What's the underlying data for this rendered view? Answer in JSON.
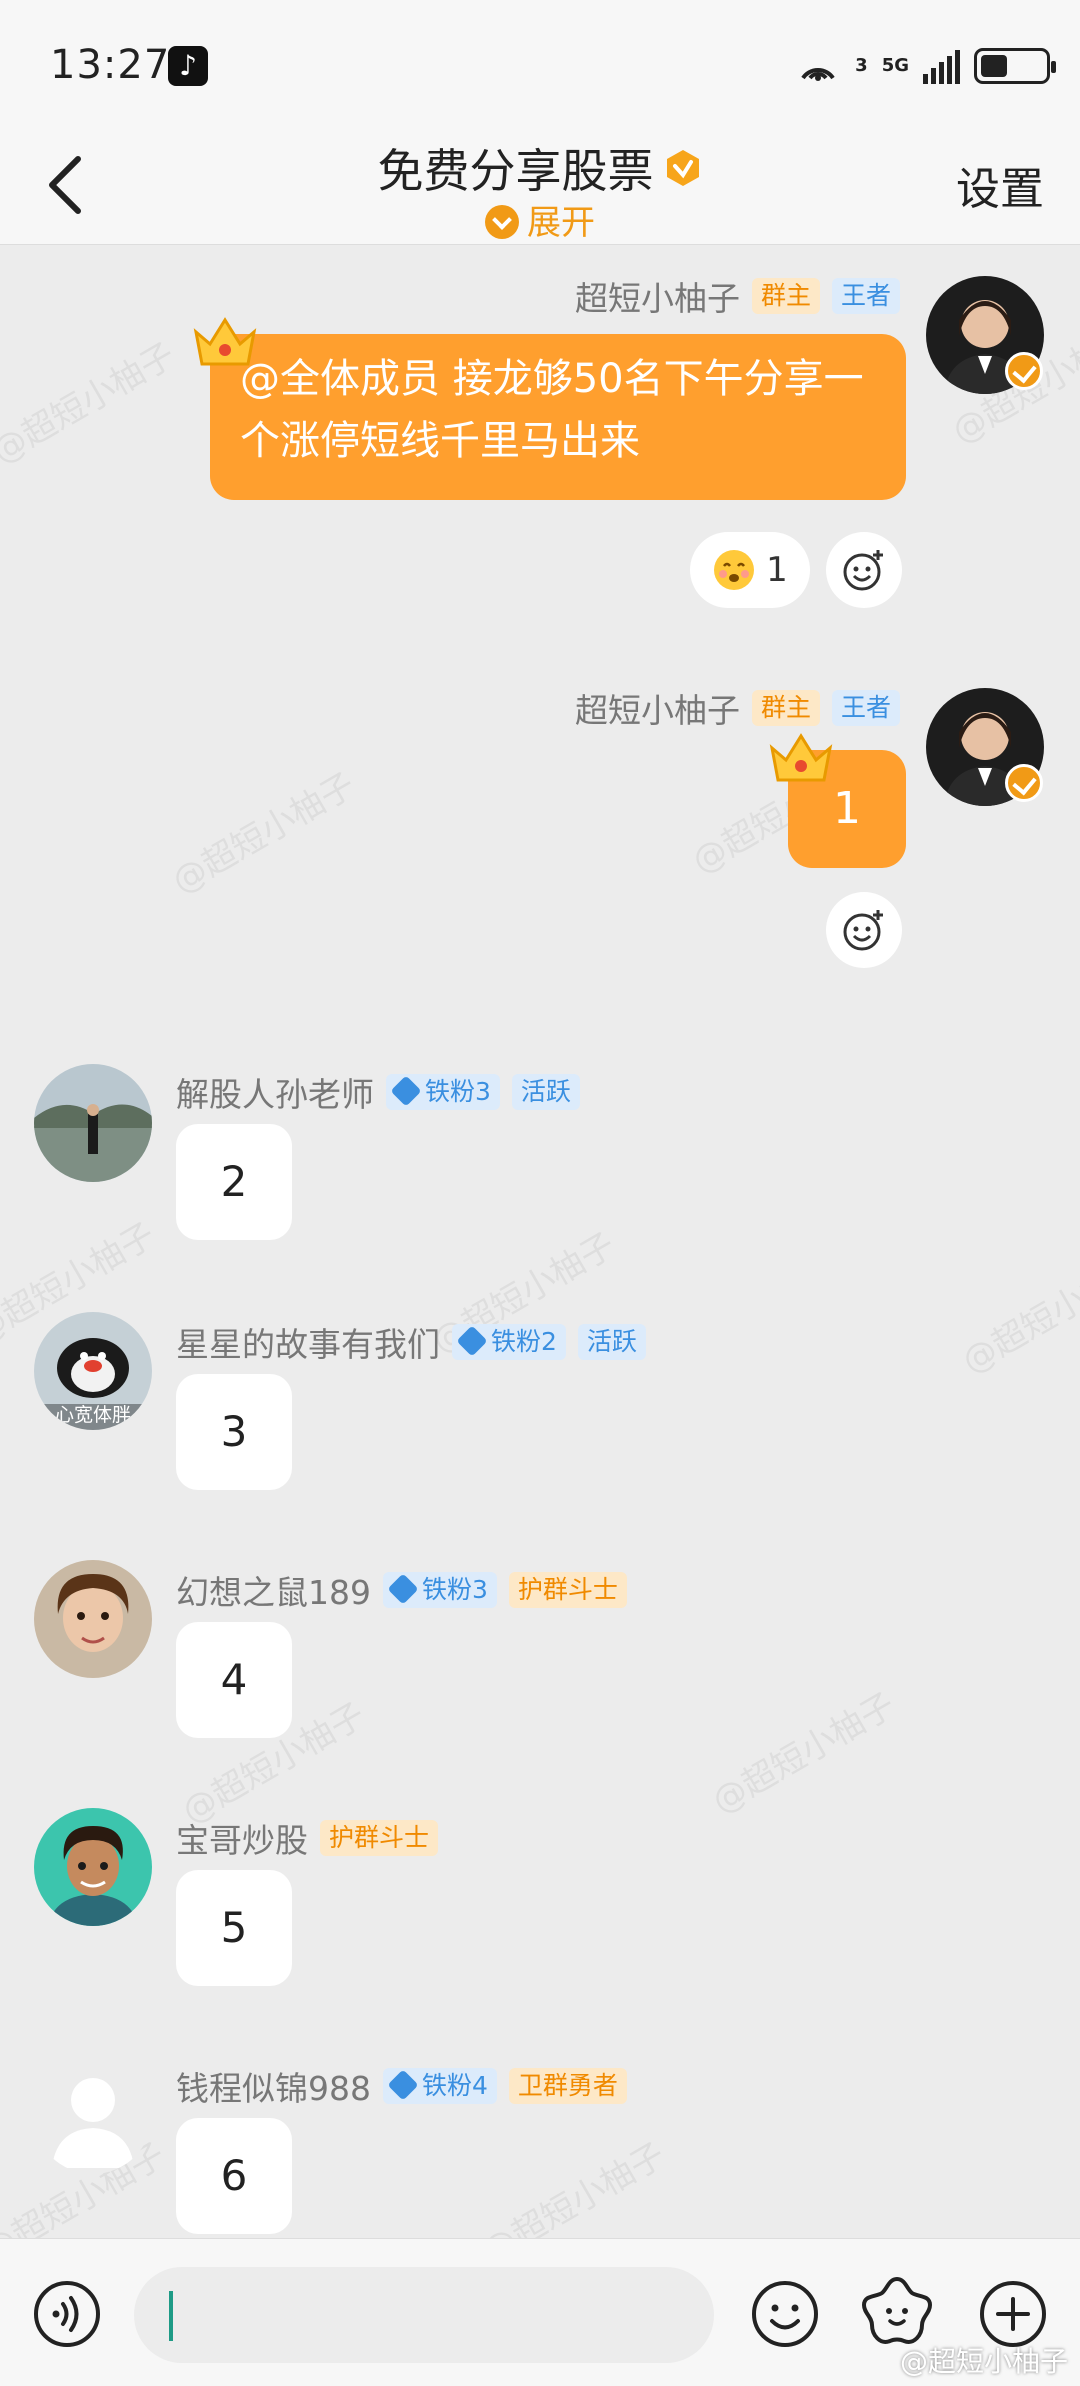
{
  "status_bar": {
    "time": "13:27",
    "network": "5G",
    "hotspot_count": "3",
    "app_icon": "tiktok-icon",
    "battery_level_percent": 40
  },
  "header": {
    "title": "免费分享股票",
    "expand_label": "展开",
    "settings_label": "设置",
    "back_icon": "chevron-left-icon"
  },
  "messages": [
    {
      "sender": "超短小柚子",
      "tags": [
        "群主",
        "王者"
      ],
      "text": "@全体成员 接龙够50名下午分享一个涨停短线千里马出来",
      "reaction_count": "1",
      "own": true
    },
    {
      "sender": "超短小柚子",
      "tags": [
        "群主",
        "王者"
      ],
      "text": "1",
      "own": true
    },
    {
      "sender": "解股人孙老师",
      "fan_tag": "铁粉3",
      "tag": "活跃",
      "text": "2"
    },
    {
      "sender": "星星的故事有我们",
      "fan_tag": "铁粉2",
      "tag": "活跃",
      "avatar_caption": "心宽体胖",
      "text": "3"
    },
    {
      "sender": "幻想之鼠189",
      "fan_tag": "铁粉3",
      "tag": "护群斗士",
      "text": "4"
    },
    {
      "sender": "宝哥炒股",
      "tag": "护群斗士",
      "text": "5"
    },
    {
      "sender": "钱程似锦988",
      "fan_tag": "铁粉4",
      "tag": "卫群勇者",
      "text": "6"
    }
  ],
  "watermark": "@超短小柚子",
  "corner_watermark": "@超短小柚子",
  "input": {
    "value": "",
    "placeholder": ""
  },
  "colors": {
    "accent": "#ff9f2e",
    "tag_blue": "#3a8fe0",
    "background": "#ececec"
  }
}
